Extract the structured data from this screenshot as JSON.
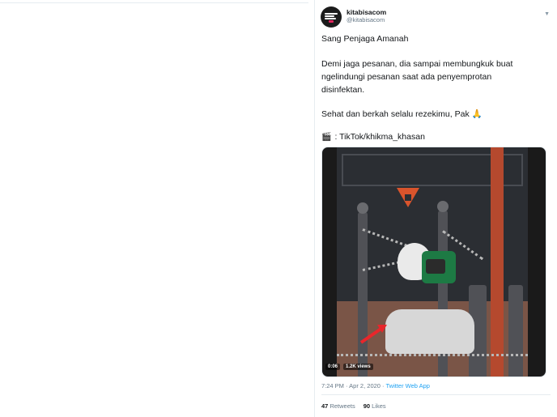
{
  "tweet": {
    "name": "kitabisacom",
    "handle": "@kitabisacom",
    "lines": [
      "Sang Penjaga Amanah",
      "Demi jaga pesanan, dia sampai membungkuk buat",
      "ngelindungi pesanan saat ada penyemprotan",
      "disinfektan.",
      "Sehat dan berkah selalu rezekimu, Pak",
      ": TikTok/khikma_khasan"
    ],
    "pray_emoji": "🙏",
    "clapper_icon": "clapper-board-icon",
    "video": {
      "duration": "0:06",
      "views": "1.2K views"
    },
    "meta": {
      "time": "7:24 PM · Apr 2, 2020 · ",
      "app": "Twitter Web App"
    },
    "stats": {
      "retweets_count": "47",
      "retweets_label": "Retweets",
      "likes_count": "90",
      "likes_label": "Likes"
    }
  },
  "colors": {
    "text": "#14171a",
    "secondary": "#657786",
    "link": "#1da1f2",
    "divider": "#e6ecf0"
  }
}
